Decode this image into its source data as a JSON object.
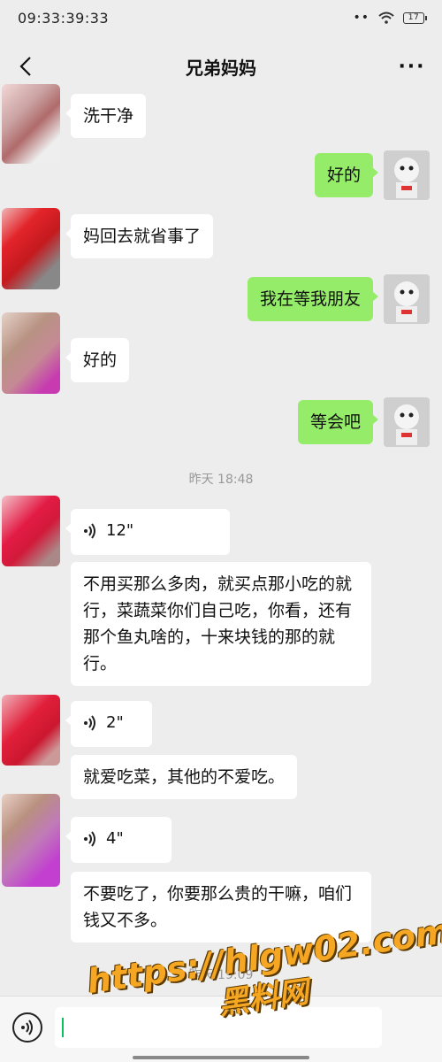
{
  "status_bar": {
    "time": "09:33:39:33",
    "battery": "17"
  },
  "nav": {
    "title": "兄弟妈妈",
    "more": "···"
  },
  "messages": [
    {
      "text": "洗干净"
    },
    {
      "text": "好的"
    },
    {
      "text": "妈回去就省事了"
    },
    {
      "text": "我在等我朋友"
    },
    {
      "text": "好的"
    },
    {
      "text": "等会吧"
    },
    {
      "text": "12\""
    },
    {
      "text": "不用买那么多肉，就买点那小吃的就行，菜蔬菜你们自己吃，你看，还有那个鱼丸啥的，十来块钱的那的就行。"
    },
    {
      "text": "2\""
    },
    {
      "text": "就爱吃菜，其他的不爱吃。"
    },
    {
      "text": "4\""
    },
    {
      "text": "不要吃了，你要那么贵的干嘛，咱们钱又不多。"
    }
  ],
  "timestamps": {
    "t1": "昨天 18:48",
    "t2": "昨天 19:09"
  },
  "watermark": {
    "url": "https://hlgw02.com",
    "name": "黑料网"
  },
  "icons": {
    "back": "chevron-left-icon",
    "voice": "voice-wave-icon",
    "wifi": "wifi-icon",
    "battery": "battery-icon"
  },
  "colors": {
    "outgoing": "#95ec69",
    "incoming": "#ffffff",
    "background": "#ededed"
  }
}
